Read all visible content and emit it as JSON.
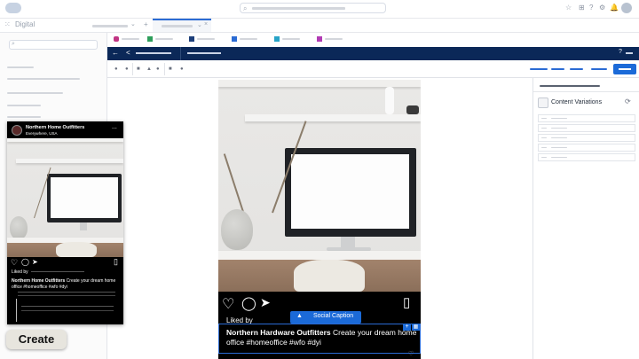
{
  "header": {
    "app_name": "Digital",
    "search_icon": "magnifier-icon",
    "icons": [
      "star-icon",
      "plus-icon",
      "help-icon",
      "gear-icon",
      "bell-icon"
    ]
  },
  "mini_post": {
    "account_name": "Northern Home Outfitters",
    "location": "Everywhere, USA",
    "menu": "...",
    "liked_by": "Liked by",
    "caption_bold": "Northern Home Outfitters",
    "caption_text": " Create your dream home office #homeoffice #wfo #dyi"
  },
  "main_post": {
    "liked_by": "Liked by",
    "caption_bold": "Northern Hardware Outfitters",
    "caption_text": " Create your dream home office #homeoffice #wfo #dyi"
  },
  "tooltip": {
    "label": "Social Caption"
  },
  "right_panel": {
    "title": "Content Variations"
  },
  "create_button": {
    "label": "Create"
  },
  "colors": {
    "nav_blue": "#0b2858",
    "accent_blue": "#2b6bd4"
  }
}
